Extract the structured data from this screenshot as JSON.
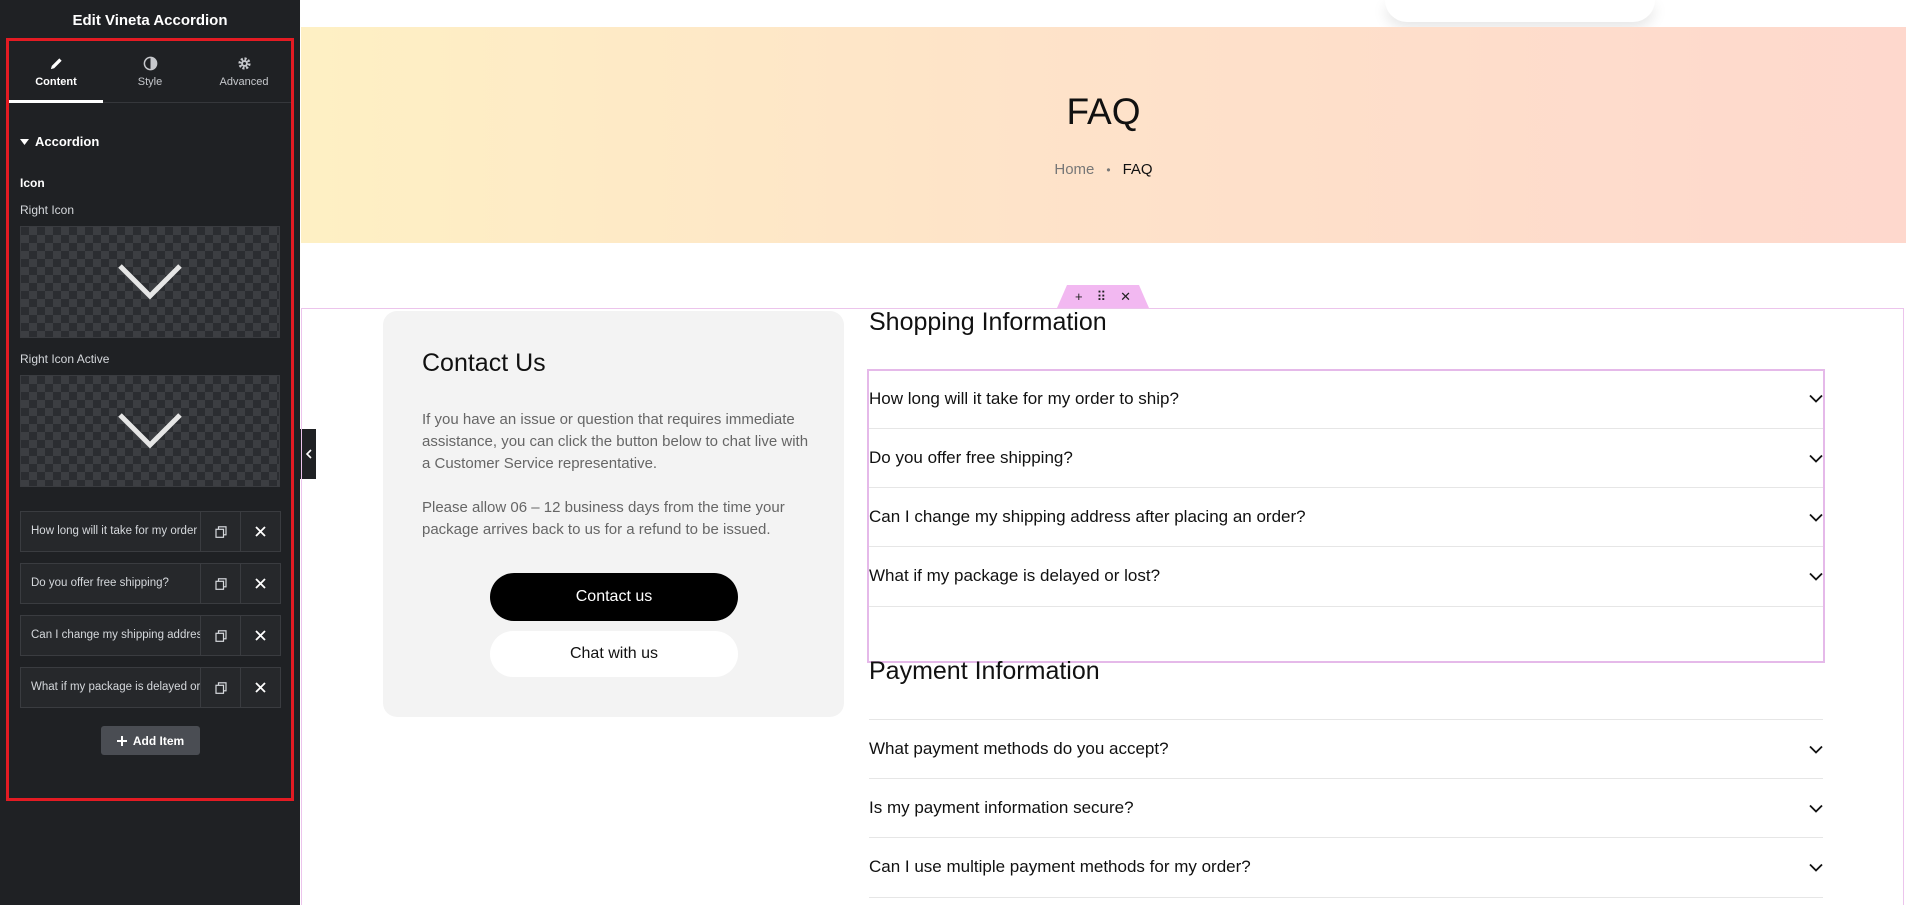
{
  "panel": {
    "title": "Edit Vineta Accordion",
    "tabs": [
      {
        "label": "Content",
        "icon": "pencil-icon",
        "active": true
      },
      {
        "label": "Style",
        "icon": "half-circle-icon",
        "active": false
      },
      {
        "label": "Advanced",
        "icon": "gear-icon",
        "active": false
      }
    ],
    "section_title": "Accordion",
    "icon_heading": "Icon",
    "right_icon_label": "Right Icon",
    "right_icon_active_label": "Right Icon Active",
    "items": [
      {
        "title": "How long will it take for my order to ship?"
      },
      {
        "title": "Do you offer free shipping?"
      },
      {
        "title": "Can I change my shipping address after placing an order?"
      },
      {
        "title": "What if my package is delayed or lost?"
      }
    ],
    "add_item_label": "Add Item"
  },
  "hero": {
    "title": "FAQ",
    "breadcrumb_home": "Home",
    "breadcrumb_separator": "•",
    "breadcrumb_current": "FAQ"
  },
  "section_handle": {
    "add": "+",
    "move": "⠿",
    "close": "✕"
  },
  "contact": {
    "title": "Contact Us",
    "text_1": "If you have an issue or question that requires immediate assistance, you can click the button below to chat live with a Customer Service representative.",
    "text_2": "Please allow 06 – 12 business days from the time your package arrives back to us for a refund to be issued.",
    "primary_button": "Contact us",
    "secondary_button": "Chat with us"
  },
  "faq": {
    "shopping_title": "Shopping Information",
    "shopping_items": [
      "How long will it take for my order to ship?",
      "Do you offer free shipping?",
      "Can I change my shipping address after placing an order?",
      "What if my package is delayed or lost?"
    ],
    "payment_title": "Payment Information",
    "payment_items": [
      "What payment methods do you accept?",
      "Is my payment information secure?",
      "Can I use multiple payment methods for my order?"
    ]
  },
  "colors": {
    "panel_bg": "#1f2124",
    "highlight_frame": "#e31b23",
    "section_outline": "#ecc4ec",
    "hero_gradient_start": "#fef0c4",
    "hero_gradient_end": "#fed8cd",
    "primary_button_bg": "#000000"
  }
}
